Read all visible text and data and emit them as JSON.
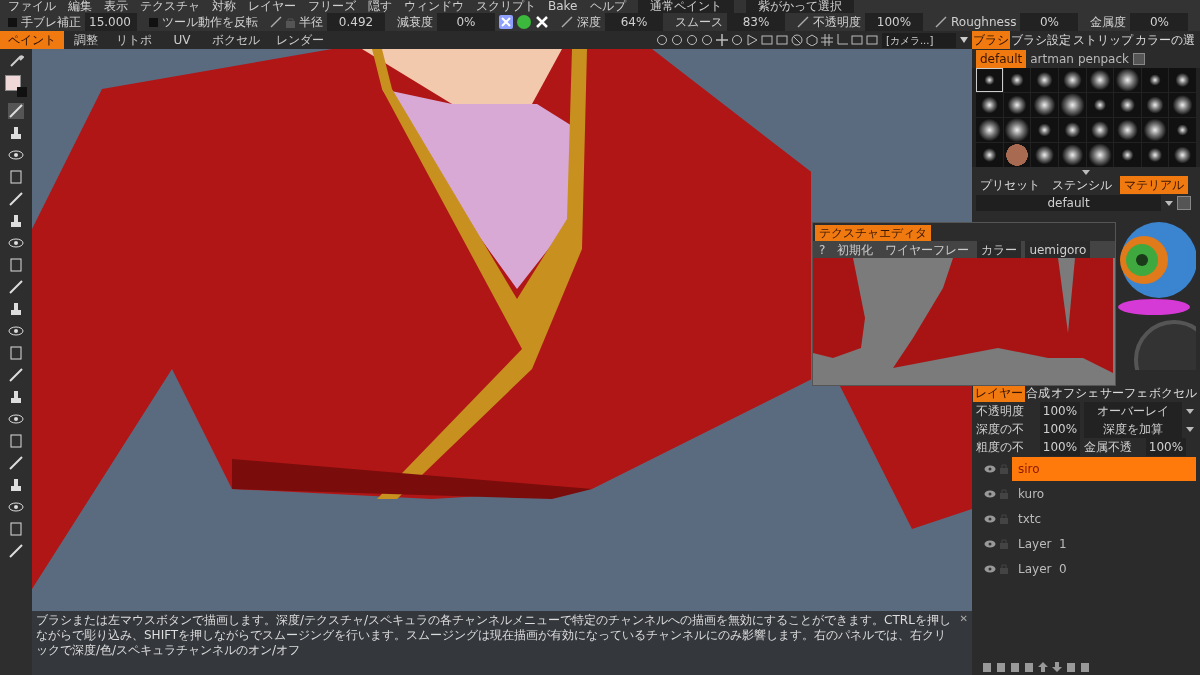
{
  "menu": [
    "ファイル",
    "編集",
    "表示",
    "テクスチャ",
    "対称",
    "レイヤー",
    "フリーズ",
    "隠す",
    "ウィンドウ",
    "スクリプト",
    "Bake",
    "ヘルプ"
  ],
  "top_dropdowns": [
    "通常ペイント",
    "紫がかって選択"
  ],
  "tool_options": [
    {
      "kind": "checked_field",
      "label": "手ブレ補正",
      "value": "15.000",
      "checked": false
    },
    {
      "kind": "checkbox",
      "label": "ツール動作を反転",
      "checked": false
    },
    {
      "kind": "field",
      "label": "半径",
      "value": "0.492"
    },
    {
      "kind": "field",
      "label": "減衰度",
      "value": "0%"
    },
    {
      "kind": "field",
      "label": "深度",
      "value": "64%"
    },
    {
      "kind": "field",
      "label": "スムース",
      "value": "83%"
    },
    {
      "kind": "field",
      "label": "不透明度",
      "value": "100%"
    },
    {
      "kind": "field",
      "label": "Roughness",
      "value": "0%"
    },
    {
      "kind": "field",
      "label": "金属度",
      "value": "0%"
    }
  ],
  "mode_tabs": [
    {
      "label": "ペイント",
      "selected": true
    },
    {
      "label": "調整",
      "selected": false
    },
    {
      "label": "リトポ",
      "selected": false
    },
    {
      "label": "UV",
      "selected": false
    },
    {
      "label": "ボクセル",
      "selected": false
    },
    {
      "label": "レンダー",
      "selected": false
    }
  ],
  "camera_dropdown": "[カメラ...]",
  "right_tabs": [
    {
      "label": "ブラシ",
      "selected": true
    },
    {
      "label": "ブラシ設定",
      "selected": false
    },
    {
      "label": "ストリップ",
      "selected": false
    },
    {
      "label": "カラーの選",
      "selected": false
    }
  ],
  "brush_sets": [
    {
      "label": "default",
      "selected": true
    },
    {
      "label": "artman",
      "selected": false
    },
    {
      "label": "penpack",
      "selected": false
    }
  ],
  "material_tabs": [
    {
      "label": "プリセット",
      "selected": false
    },
    {
      "label": "ステンシル",
      "selected": false
    },
    {
      "label": "マテリアル",
      "selected": true
    }
  ],
  "material_dropdown": "default",
  "texture_editor": {
    "title": "テクスチャエディタ",
    "buttons": [
      "?",
      "初期化",
      "ワイヤーフレー"
    ],
    "dropdowns": [
      "カラー",
      "uemigoro"
    ]
  },
  "layer_tabs": [
    {
      "label": "レイヤー",
      "selected": true
    },
    {
      "label": "合成",
      "selected": false
    },
    {
      "label": "オフシェ",
      "selected": false
    },
    {
      "label": "サーフェ",
      "selected": false
    },
    {
      "label": "ボクセル",
      "selected": false
    }
  ],
  "layer_props": [
    {
      "kind": "dropdown",
      "label": "不透明度",
      "value": "100%",
      "option": "オーバーレイ"
    },
    {
      "kind": "dropdown",
      "label": "深度の不",
      "value": "100%",
      "option": "深度を加算"
    },
    {
      "kind": "pair",
      "label": "粗度の不",
      "value": "100%",
      "label2": "金属不透",
      "value2": "100%"
    }
  ],
  "layers": [
    {
      "name": "siro",
      "selected": true
    },
    {
      "name": "kuro",
      "selected": false
    },
    {
      "name": "txtc",
      "selected": false
    },
    {
      "name": "Layer  1",
      "selected": false
    },
    {
      "name": "Layer  0",
      "selected": false
    }
  ],
  "help_close": "✕",
  "help_text": "ブラシまたは左マウスボタンで描画します。深度/テクスチャ/スペキュラの各チャンネルメニューで特定のチャンネルへの描画を無効にすることができます。CTRLを押しながらで彫り込み、SHIFTを押しながらでスムージングを行います。スムージングは現在描画が有効になっているチャンネルにのみ影響します。右のパネルでは、右クリックで深度/色/スペキュラチャンネルのオン/オフ"
}
